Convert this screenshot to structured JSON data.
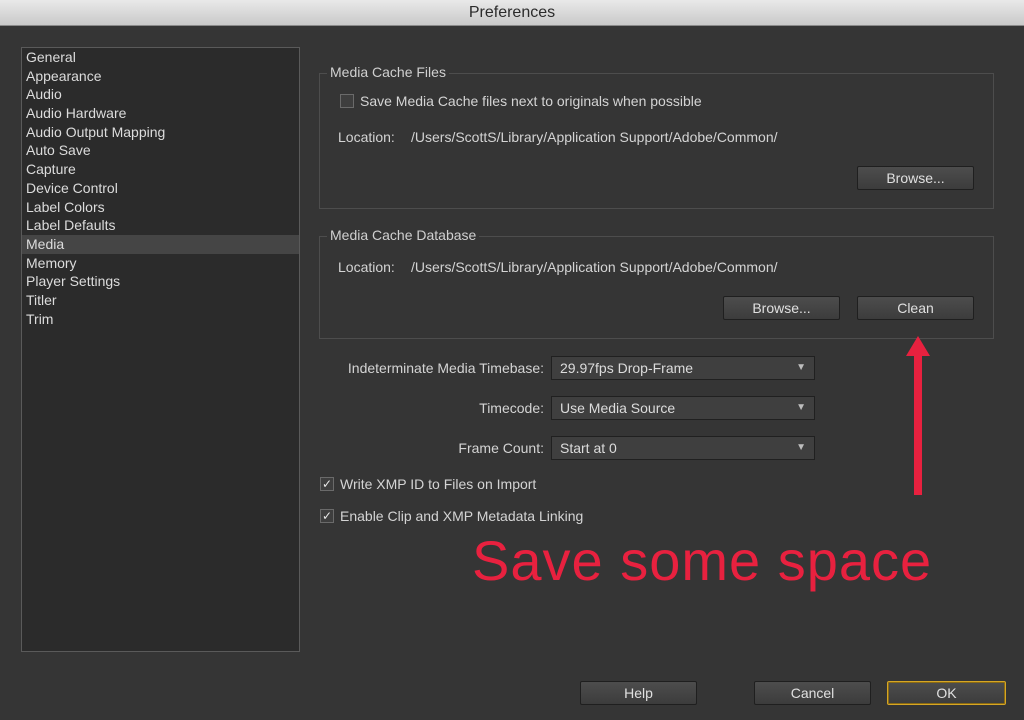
{
  "window": {
    "title": "Preferences"
  },
  "sidebar": {
    "items": [
      {
        "label": "General"
      },
      {
        "label": "Appearance"
      },
      {
        "label": "Audio"
      },
      {
        "label": "Audio Hardware"
      },
      {
        "label": "Audio Output Mapping"
      },
      {
        "label": "Auto Save"
      },
      {
        "label": "Capture"
      },
      {
        "label": "Device Control"
      },
      {
        "label": "Label Colors"
      },
      {
        "label": "Label Defaults"
      },
      {
        "label": "Media",
        "selected": true
      },
      {
        "label": "Memory"
      },
      {
        "label": "Player Settings"
      },
      {
        "label": "Titler"
      },
      {
        "label": "Trim"
      }
    ]
  },
  "cache_files": {
    "title": "Media Cache Files",
    "checkbox_label": "Save Media Cache files next to originals when possible",
    "checkbox_checked": false,
    "location_label": "Location:",
    "location_value": "/Users/ScottS/Library/Application Support/Adobe/Common/",
    "browse_label": "Browse..."
  },
  "cache_db": {
    "title": "Media Cache Database",
    "location_label": "Location:",
    "location_value": "/Users/ScottS/Library/Application Support/Adobe/Common/",
    "browse_label": "Browse...",
    "clean_label": "Clean"
  },
  "settings": {
    "timebase_label": "Indeterminate Media Timebase:",
    "timebase_value": "29.97fps Drop-Frame",
    "timecode_label": "Timecode:",
    "timecode_value": "Use Media Source",
    "framecount_label": "Frame Count:",
    "framecount_value": "Start at 0",
    "xmp_label": "Write XMP ID to Files on Import",
    "xmp_checked": true,
    "linking_label": "Enable Clip and XMP Metadata Linking",
    "linking_checked": true
  },
  "annotation": {
    "text": "Save some space",
    "color": "#e8213f"
  },
  "footer": {
    "help_label": "Help",
    "cancel_label": "Cancel",
    "ok_label": "OK"
  },
  "icons": {
    "checkmark": "✓",
    "dropdown": "▼"
  }
}
